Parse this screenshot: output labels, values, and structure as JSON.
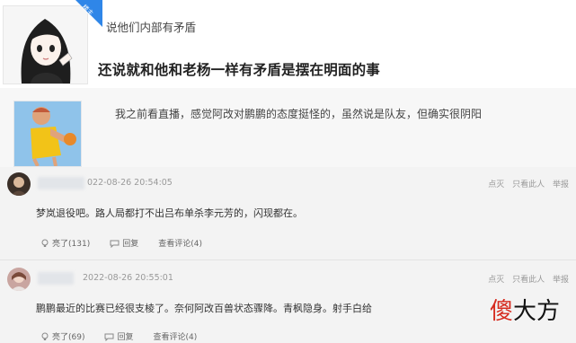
{
  "quoted": {
    "badge": "楼主",
    "post1": {
      "line1": "说他们内部有矛盾",
      "line2": "还说就和他和老杨一样有矛盾是摆在明面的事"
    },
    "post2": {
      "line1": "我之前看直播，感觉阿改对鹏鹏的态度挺怪的，虽然说是队友，但确实很阴阳"
    }
  },
  "comments": [
    {
      "time": "022-08-26 20:54:05",
      "actions": [
        "点灭",
        "只看此人",
        "举报"
      ],
      "text": "梦岚退役吧。路人局都打不出吕布单杀李元芳的，闪现都在。",
      "footer": {
        "like": "亮了(131)",
        "reply": "回复",
        "view": "查看评论(4)"
      }
    },
    {
      "time": "2022-08-26 20:55:01",
      "actions": [
        "点灭",
        "只看此人",
        "举报"
      ],
      "text": "鹏鹏最近的比赛已经很支棱了。奈何阿改百兽状态骤降。青枫隐身。射手白给",
      "footer": {
        "like": "亮了(69)",
        "reply": "回复",
        "view": "查看评论(4)"
      }
    }
  ],
  "watermark": {
    "first": "傻",
    "rest": "大方"
  }
}
